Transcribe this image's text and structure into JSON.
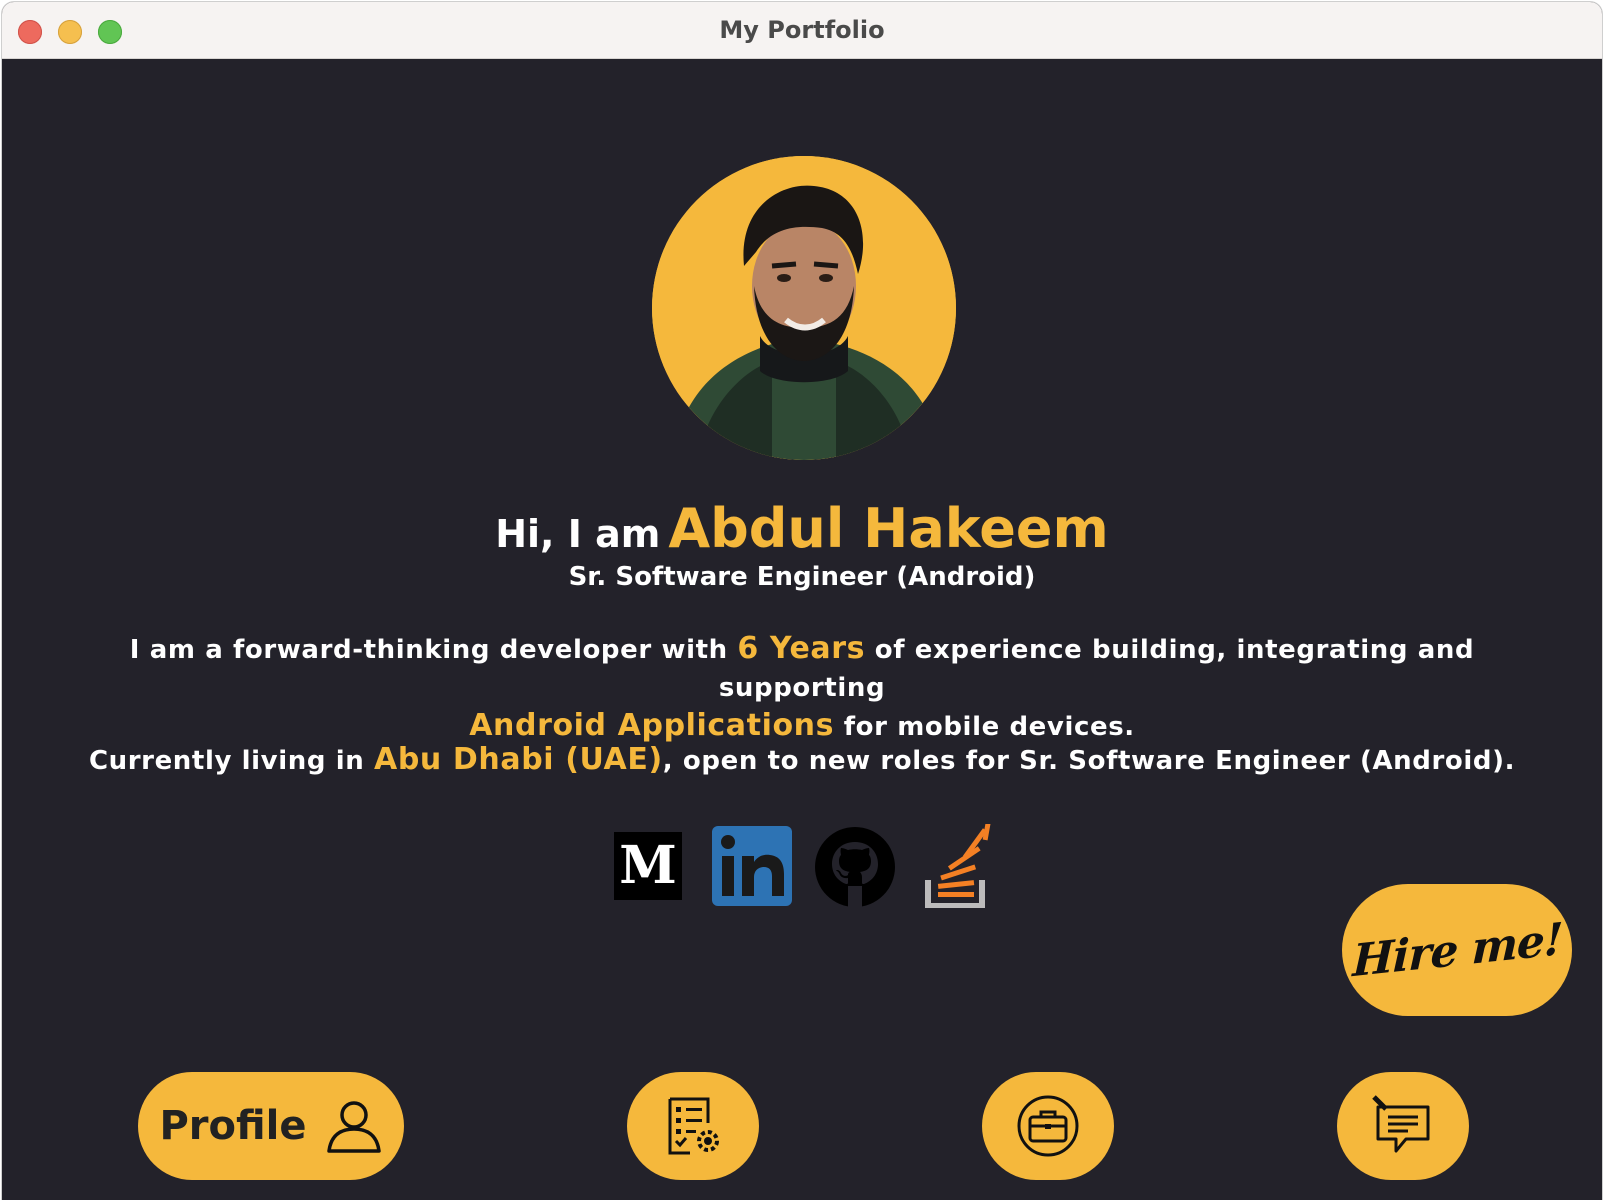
{
  "window": {
    "title": "My Portfolio"
  },
  "hero": {
    "greeting": "Hi, I am",
    "name": "Abdul Hakeem",
    "role": "Sr. Software Engineer (Android)",
    "bio_part1": "I am a forward-thinking developer with ",
    "bio_years": "6 Years",
    "bio_part2": " of experience building, integrating and supporting",
    "bio_apps": "Android Applications",
    "bio_part3": " for mobile devices.",
    "loc_part1": "Currently living in ",
    "loc_city": "Abu Dhabi (UAE)",
    "loc_part2": ", open to new roles for Sr. Software Engineer (Android)."
  },
  "social": {
    "medium_letter": "M",
    "linkedin_text": "in"
  },
  "hire_button": {
    "label": "Hire me!"
  },
  "bottom_nav": {
    "profile_label": "Profile",
    "items": [
      "profile-icon",
      "skills-icon",
      "work-briefcase-icon",
      "blog-chat-icon"
    ]
  },
  "colors": {
    "accent": "#f5b83c",
    "background": "#23222a",
    "text": "#ffffff"
  }
}
